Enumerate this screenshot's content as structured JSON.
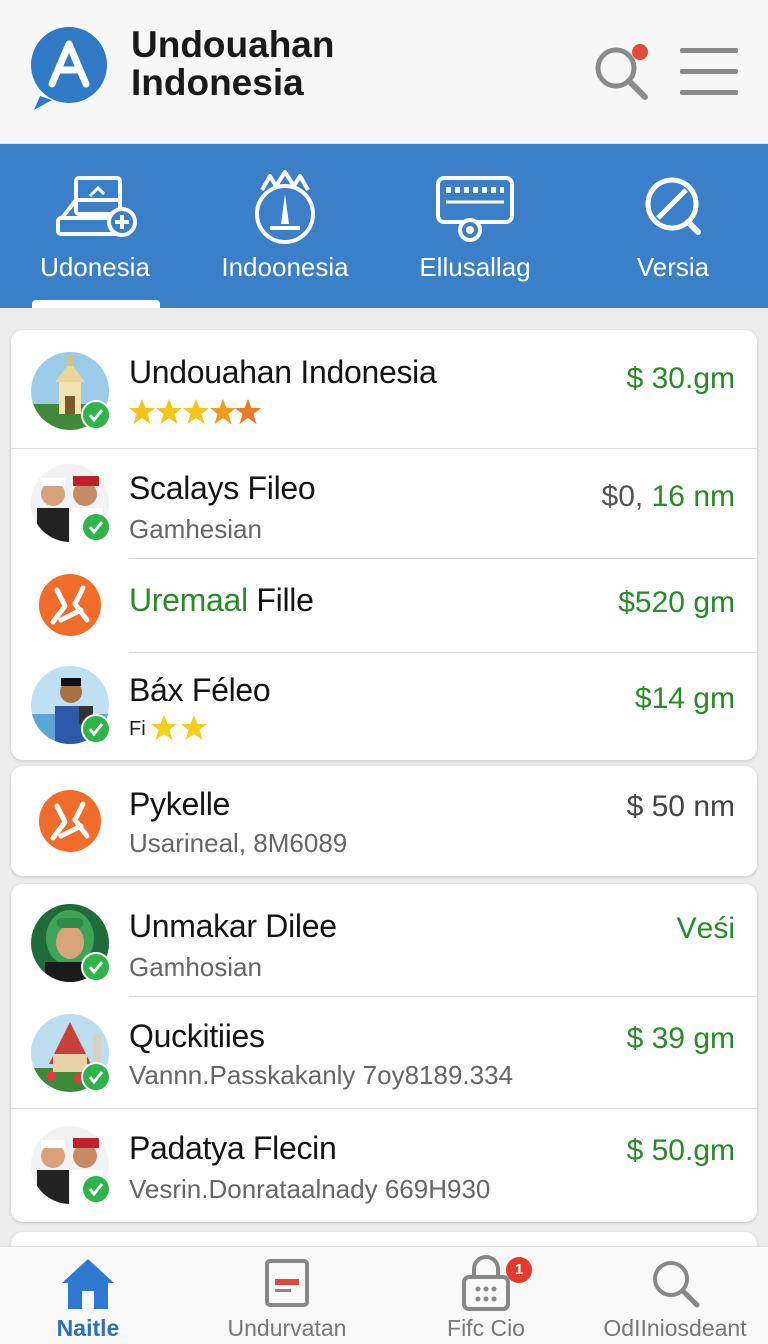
{
  "header": {
    "app_title_line1": "Undouahan",
    "app_title_line2": "Indonesia",
    "logo_icon": "chat-bubble-a-logo",
    "search_icon": "search-icon",
    "menu_icon": "hamburger-menu-icon",
    "notification_dot_color": "#e64a3b"
  },
  "tabs": [
    {
      "label": "Udonesia",
      "icon": "map-pin-add-icon",
      "selected": true
    },
    {
      "label": "Indoonesia",
      "icon": "monument-icon",
      "selected": false
    },
    {
      "label": "Ellusallag",
      "icon": "storefront-icon",
      "selected": false
    },
    {
      "label": "Versia",
      "icon": "search-slash-icon",
      "selected": false
    }
  ],
  "listings": [
    {
      "title": "Undouahan Indonesia",
      "rating_stars": 5,
      "price": "$ 30.gm",
      "price_style": "green",
      "avatar": "temple-photo",
      "verified": true
    },
    {
      "title": "Scalays Fileo",
      "subtitle": "Gamhesian",
      "price_prefix": "$0,",
      "price": "16 nm",
      "avatar": "couple-photo",
      "verified": true
    },
    {
      "title_highlight": "Uremaal",
      "title_rest": "Fille",
      "price": "$520 gm",
      "avatar": "orange-x-logo",
      "verified": false
    },
    {
      "title": "Báx Féleo",
      "subtitle_prefix": "Fi",
      "rating_stars": 2,
      "price": "$14 gm",
      "avatar": "man-tablet-photo",
      "verified": true
    },
    {
      "title": "Pykelle",
      "subtitle": "Usarineal, 8M6089",
      "price": "$ 50 nm",
      "avatar": "orange-x-logo",
      "verified": false
    },
    {
      "title": "Unmakar Dilee",
      "subtitle": "Gamhosian",
      "price": "Vеśi",
      "avatar": "woman-hijab-photo",
      "verified": true
    },
    {
      "title": "Quckitiies",
      "subtitle": "Vannn.Passkakanly 7oy8189.334",
      "price": "$ 39 gm",
      "avatar": "palace-photo",
      "verified": true
    },
    {
      "title": "Padatya Flecin",
      "subtitle": "Vesrin.Donrataalnady 669H930",
      "price": "$ 50.gm",
      "avatar": "couple-photo",
      "verified": true
    }
  ],
  "bottom_nav": [
    {
      "label": "Naitle",
      "icon": "home-icon",
      "active": true
    },
    {
      "label": "Undurvatan",
      "icon": "card-icon",
      "active": false
    },
    {
      "label": "Fifc Cio",
      "icon": "lock-bag-icon",
      "active": false,
      "badge": "1"
    },
    {
      "label": "OdIIniosdeant",
      "icon": "search-icon",
      "active": false
    }
  ],
  "colors": {
    "accent_blue": "#3a7fc8",
    "price_green": "#2a8a2a",
    "verified_green": "#2fb34a",
    "badge_red": "#e23b2e"
  }
}
